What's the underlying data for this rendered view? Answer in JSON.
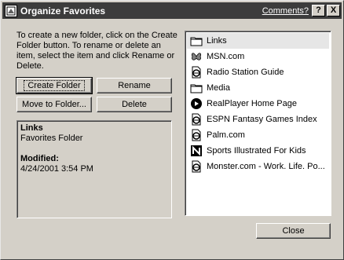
{
  "window": {
    "title": "Organize Favorites",
    "help_link": "Comments?",
    "help_button": "?",
    "close_button": "X"
  },
  "instructions": "To create a new folder, click on the Create Folder button. To rename or delete an item, select the item and click Rename or Delete.",
  "buttons": {
    "create_folder": "Create Folder",
    "rename": "Rename",
    "move_to_folder": "Move to Folder...",
    "delete": "Delete",
    "close": "Close"
  },
  "info": {
    "name": "Links",
    "type": "Favorites Folder",
    "modified_label": "Modified:",
    "modified_value": "4/24/2001 3:54 PM"
  },
  "favorites": [
    {
      "label": "Links",
      "icon": "folder-icon",
      "selected": true
    },
    {
      "label": "MSN.com",
      "icon": "msn-butterfly-icon",
      "selected": false
    },
    {
      "label": "Radio Station Guide",
      "icon": "ie-page-icon",
      "selected": false
    },
    {
      "label": "Media",
      "icon": "folder-icon",
      "selected": false
    },
    {
      "label": "RealPlayer Home Page",
      "icon": "realplayer-icon",
      "selected": false
    },
    {
      "label": "ESPN Fantasy Games Index",
      "icon": "ie-page-icon",
      "selected": false
    },
    {
      "label": "Palm.com",
      "icon": "ie-page-icon",
      "selected": false
    },
    {
      "label": "Sports Illustrated For Kids",
      "icon": "si-kids-icon",
      "selected": false
    },
    {
      "label": "Monster.com - Work. Life. Po...",
      "icon": "ie-page-icon",
      "selected": false
    }
  ]
}
